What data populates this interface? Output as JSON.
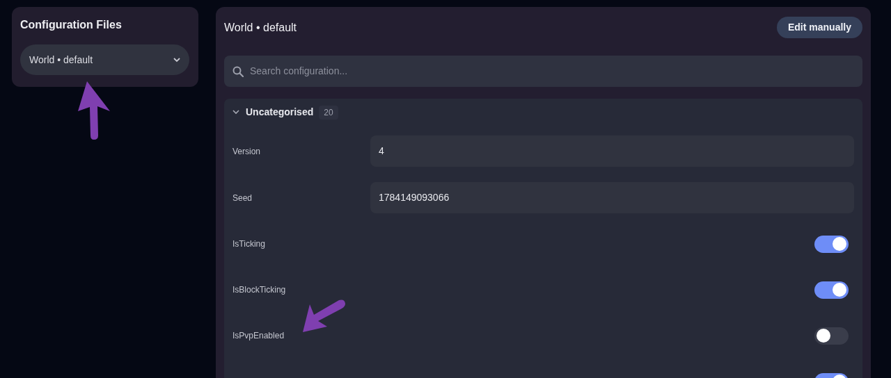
{
  "sidebar": {
    "title": "Configuration Files",
    "file_select": {
      "value": "World • default"
    }
  },
  "main": {
    "title": "World • default",
    "edit_button": "Edit manually",
    "search": {
      "placeholder": "Search configuration..."
    },
    "section": {
      "title": "Uncategorised",
      "count": "20",
      "expanded": true,
      "fields": [
        {
          "kind": "text",
          "label": "Version",
          "value": "4"
        },
        {
          "kind": "text",
          "label": "Seed",
          "value": "1784149093066"
        },
        {
          "kind": "toggle",
          "label": "IsTicking",
          "on": true
        },
        {
          "kind": "toggle",
          "label": "IsBlockTicking",
          "on": true
        },
        {
          "kind": "toggle",
          "label": "IsPvpEnabled",
          "on": false
        },
        {
          "kind": "toggle",
          "on": true
        }
      ]
    }
  }
}
